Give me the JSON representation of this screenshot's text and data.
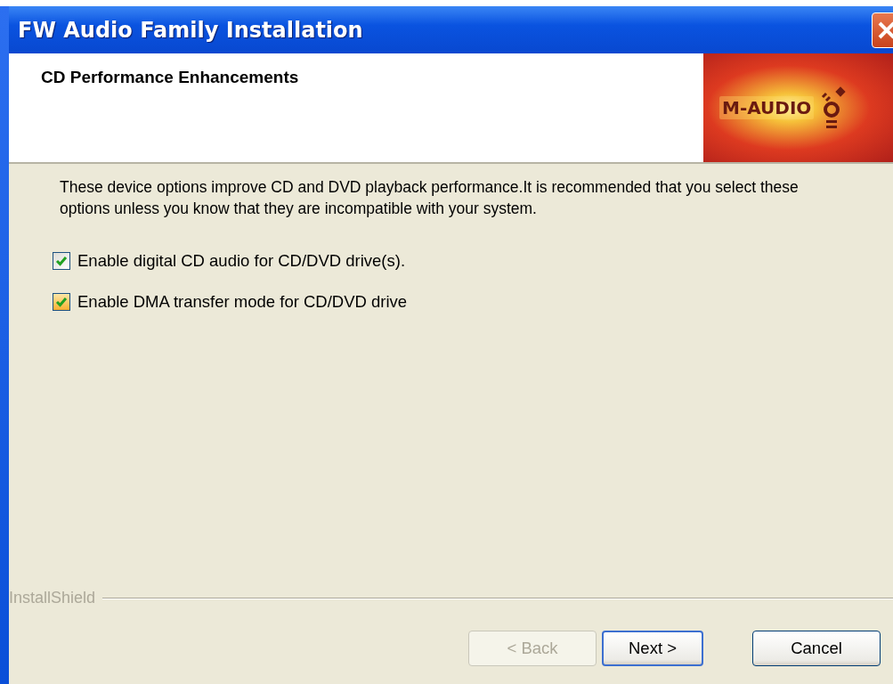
{
  "window": {
    "title": "FW Audio Family Installation"
  },
  "header": {
    "title": "CD Performance Enhancements",
    "logo_text": "M-AUDIO"
  },
  "description": "These device options improve CD and DVD playback performance.It is recommended that you select these options unless you know that they are incompatible with your system.",
  "options": [
    {
      "label": "Enable digital CD audio for CD/DVD drive(s).",
      "checked": true,
      "hovered": false
    },
    {
      "label": "Enable DMA transfer mode for CD/DVD drive",
      "checked": true,
      "hovered": true
    }
  ],
  "footer": {
    "brand": "InstallShield"
  },
  "buttons": [
    {
      "label": "< Back",
      "disabled": true,
      "default": false
    },
    {
      "label": "Next >",
      "disabled": false,
      "default": true
    },
    {
      "label": "Cancel",
      "disabled": false,
      "default": false
    }
  ]
}
